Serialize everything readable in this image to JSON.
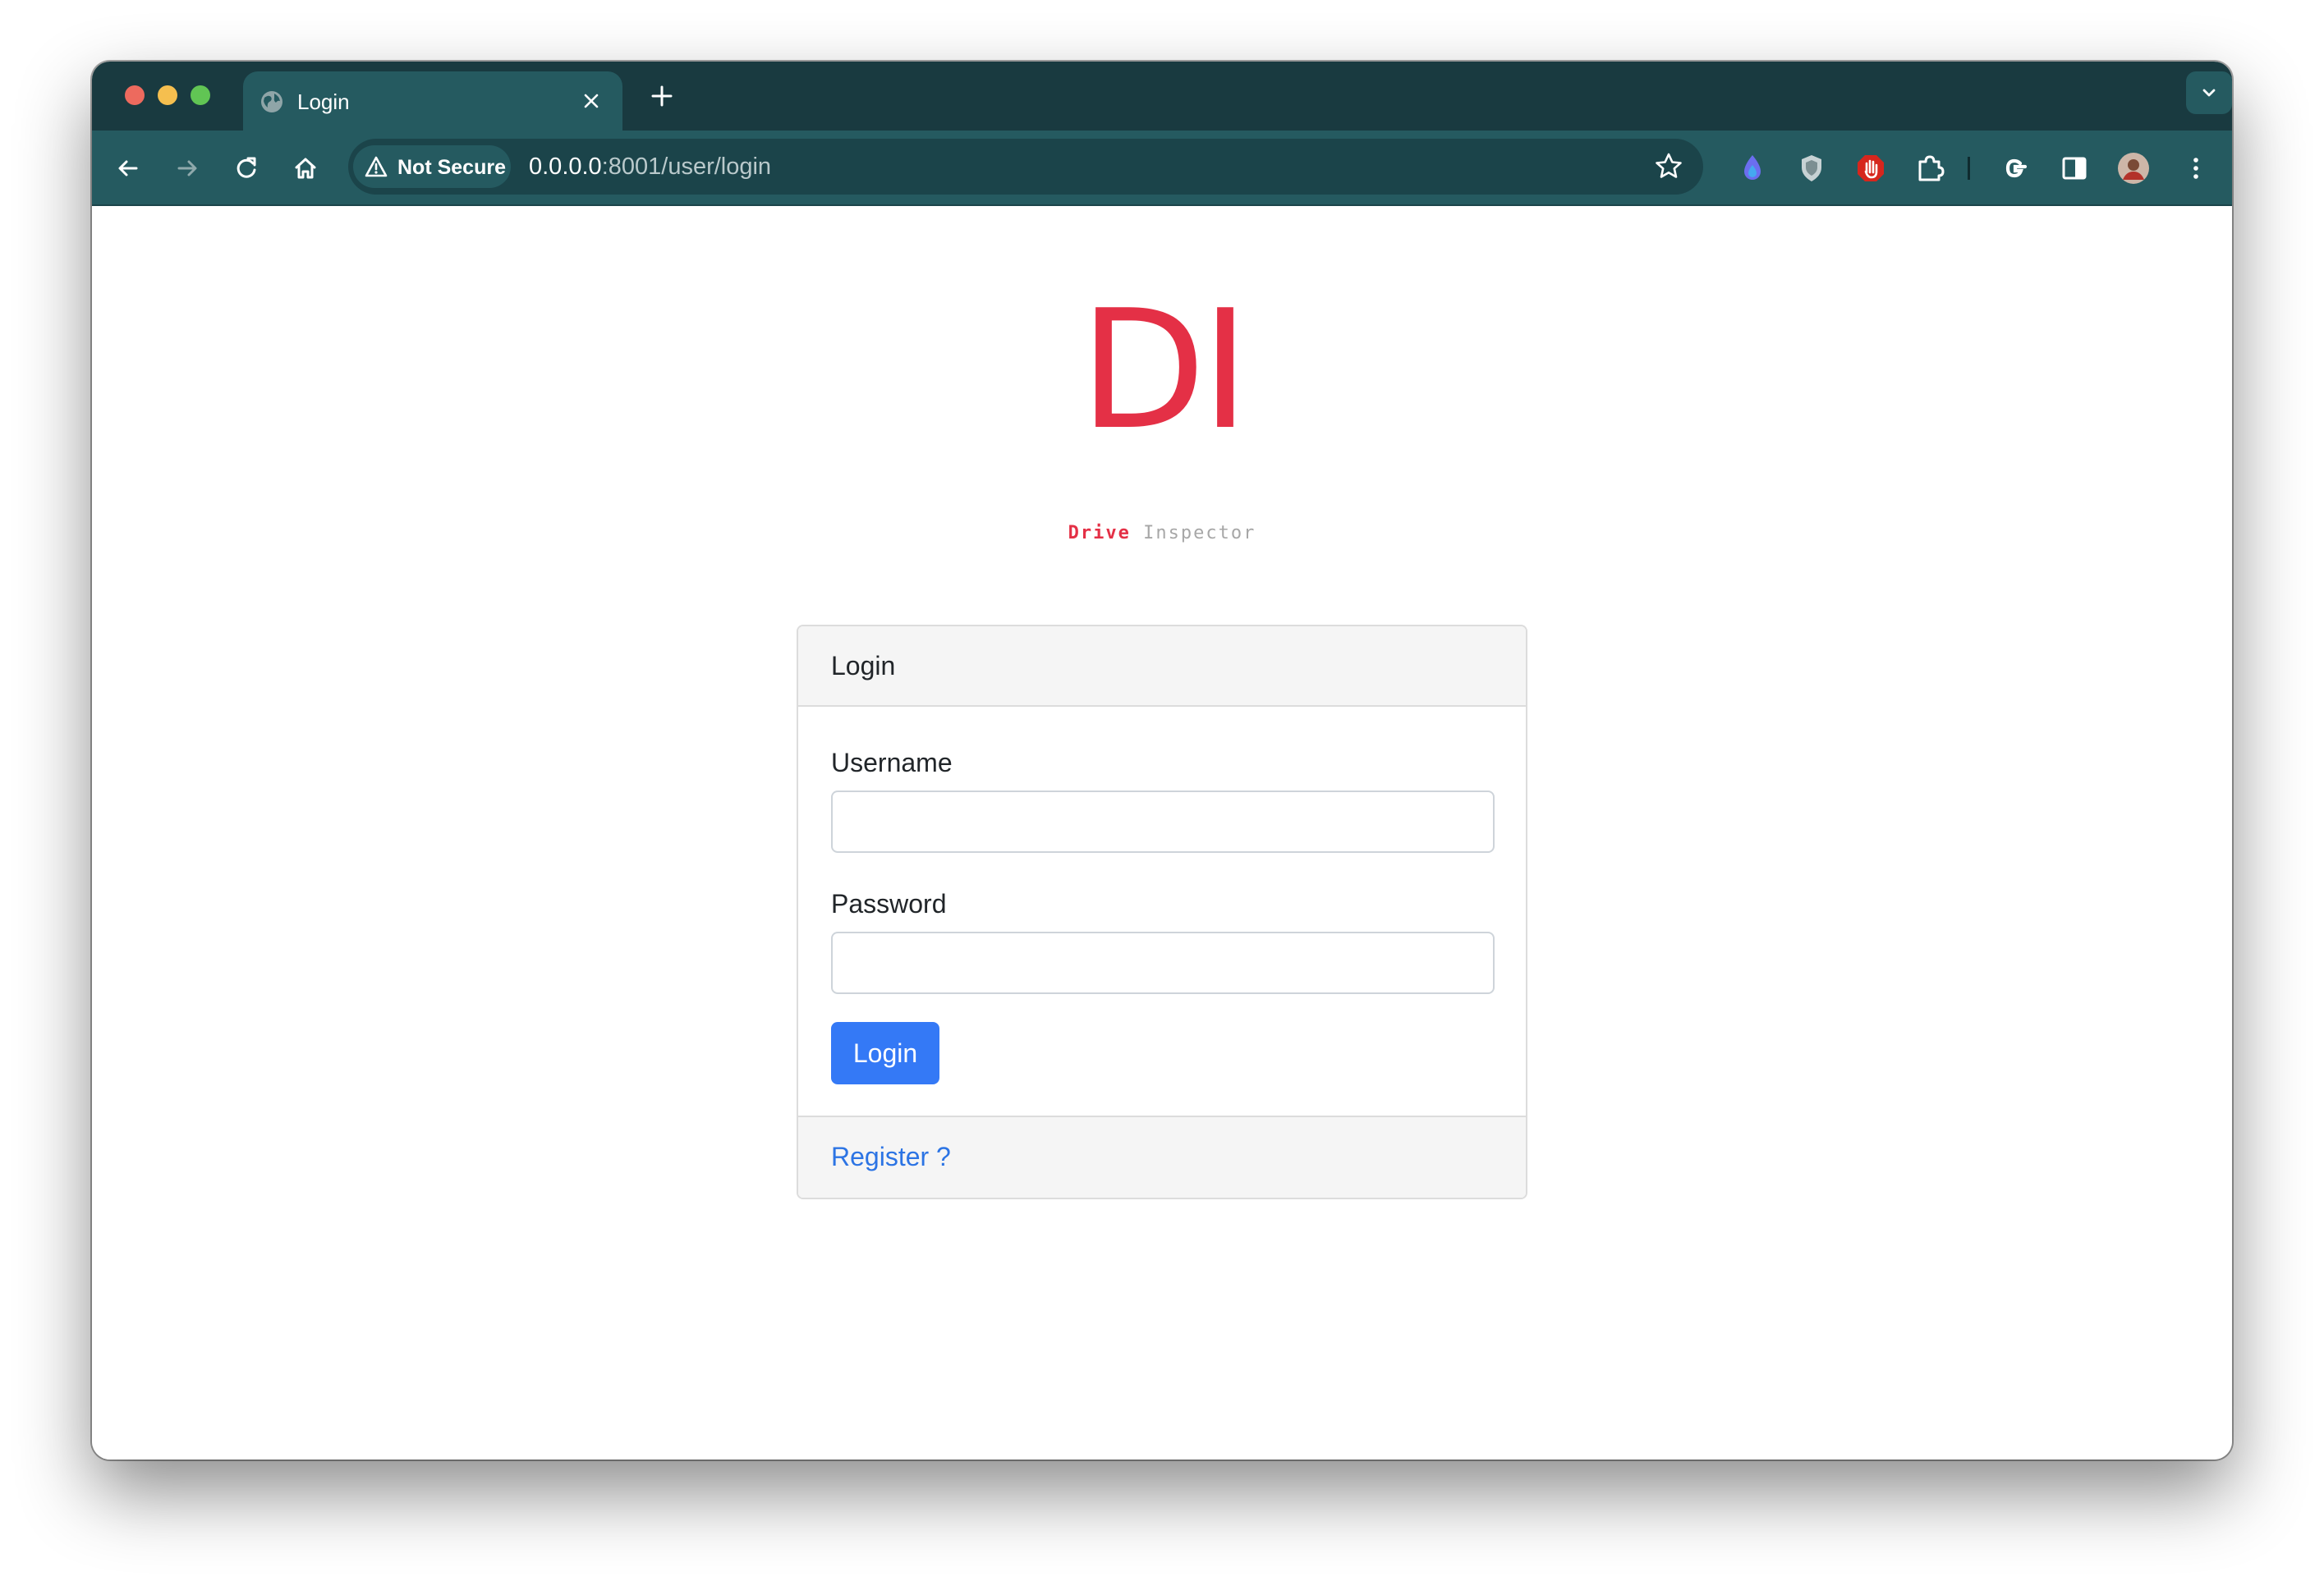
{
  "browser": {
    "tab": {
      "title": "Login",
      "icon": "globe-icon"
    },
    "address": {
      "security_label": "Not Secure",
      "host": "0.0.0.0",
      "path": ":8001/user/login"
    },
    "theme_colors": {
      "tabstrip": "#193a40",
      "toolbar": "#255a60"
    }
  },
  "logo": {
    "letters": "DI",
    "word1": "Drive",
    "word2": "Inspector",
    "accent_color": "#e43046"
  },
  "login_card": {
    "header": "Login",
    "username_label": "Username",
    "username_value": "",
    "password_label": "Password",
    "password_value": "",
    "submit_label": "Login",
    "submit_color": "#3479f6",
    "register_link": "Register ?"
  }
}
